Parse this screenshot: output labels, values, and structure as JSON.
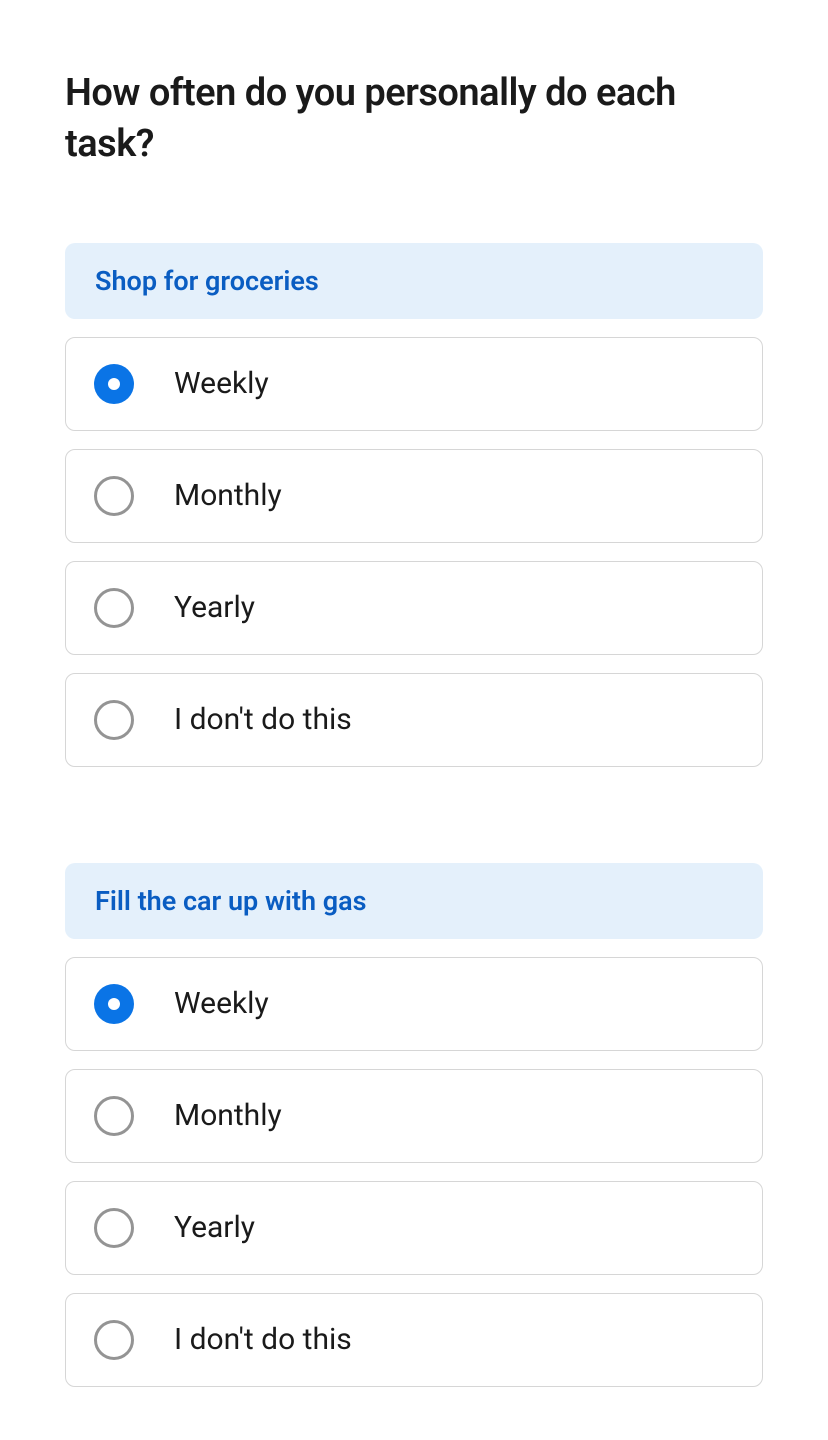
{
  "question_title": "How often do you personally do each task?",
  "groups": [
    {
      "header": "Shop for groceries",
      "selected_index": 0,
      "options": [
        {
          "label": "Weekly"
        },
        {
          "label": "Monthly"
        },
        {
          "label": "Yearly"
        },
        {
          "label": "I don't do this"
        }
      ]
    },
    {
      "header": "Fill the car up with gas",
      "selected_index": 0,
      "options": [
        {
          "label": "Weekly"
        },
        {
          "label": "Monthly"
        },
        {
          "label": "Yearly"
        },
        {
          "label": "I don't do this"
        }
      ]
    }
  ],
  "colors": {
    "accent": "#0a74e6",
    "header_bg": "#e4f0fb",
    "header_text": "#0a5dc2",
    "border": "#d6d6d6",
    "radio_border": "#949494"
  }
}
